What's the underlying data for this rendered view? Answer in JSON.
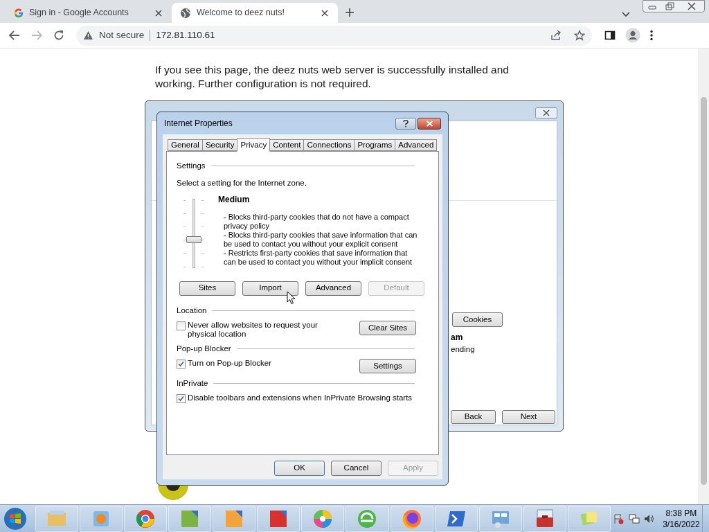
{
  "browser": {
    "tabs": [
      {
        "title": "Sign in - Google Accounts",
        "selected": false
      },
      {
        "title": "Welcome to deez nuts!",
        "selected": true
      }
    ],
    "security_label": "Not secure",
    "url": "172.81.110.61"
  },
  "page": {
    "text": "If you see this page, the deez nuts web server is successfully installed and working. Further configuration is not required."
  },
  "background_window": {
    "cookies_button": "Cookies",
    "heading_fragment": "am",
    "text_fragment": "ending",
    "back_button": "Back",
    "next_button": "Next"
  },
  "dialog": {
    "title": "Internet Properties",
    "tabs": [
      {
        "label": "General",
        "selected": false
      },
      {
        "label": "Security",
        "selected": false
      },
      {
        "label": "Privacy",
        "selected": true
      },
      {
        "label": "Content",
        "selected": false
      },
      {
        "label": "Connections",
        "selected": false
      },
      {
        "label": "Programs",
        "selected": false
      },
      {
        "label": "Advanced",
        "selected": false
      }
    ],
    "settings_heading": "Settings",
    "prompt": "Select a setting for the Internet zone.",
    "slider": {
      "level": 0.4
    },
    "level_name": "Medium",
    "description": [
      "- Blocks third-party cookies that do not have a compact privacy policy",
      "- Blocks third-party cookies that save information that can be used to contact you without your explicit consent",
      "- Restricts first-party cookies that save information that can be used to contact you without your implicit consent"
    ],
    "buttons": [
      {
        "label": "Sites",
        "disabled": false
      },
      {
        "label": "Import",
        "disabled": false
      },
      {
        "label": "Advanced",
        "disabled": false
      },
      {
        "label": "Default",
        "disabled": true
      }
    ],
    "sections": [
      {
        "heading": "Location",
        "checkbox": "Never allow websites to request your physical location",
        "checked": false,
        "button": "Clear Sites"
      },
      {
        "heading": "Pop-up Blocker",
        "checkbox": "Turn on Pop-up Blocker",
        "checked": true,
        "button": "Settings"
      },
      {
        "heading": "InPrivate",
        "checkbox": "Disable toolbars and extensions when InPrivate Browsing starts",
        "checked": true
      }
    ],
    "footer_buttons": [
      {
        "label": "OK",
        "disabled": false,
        "default": true
      },
      {
        "label": "Cancel",
        "disabled": false,
        "default": false
      },
      {
        "label": "Apply",
        "disabled": true,
        "default": false
      }
    ]
  },
  "taskbar": {
    "time": "8:38 PM",
    "date": "3/16/2022"
  }
}
